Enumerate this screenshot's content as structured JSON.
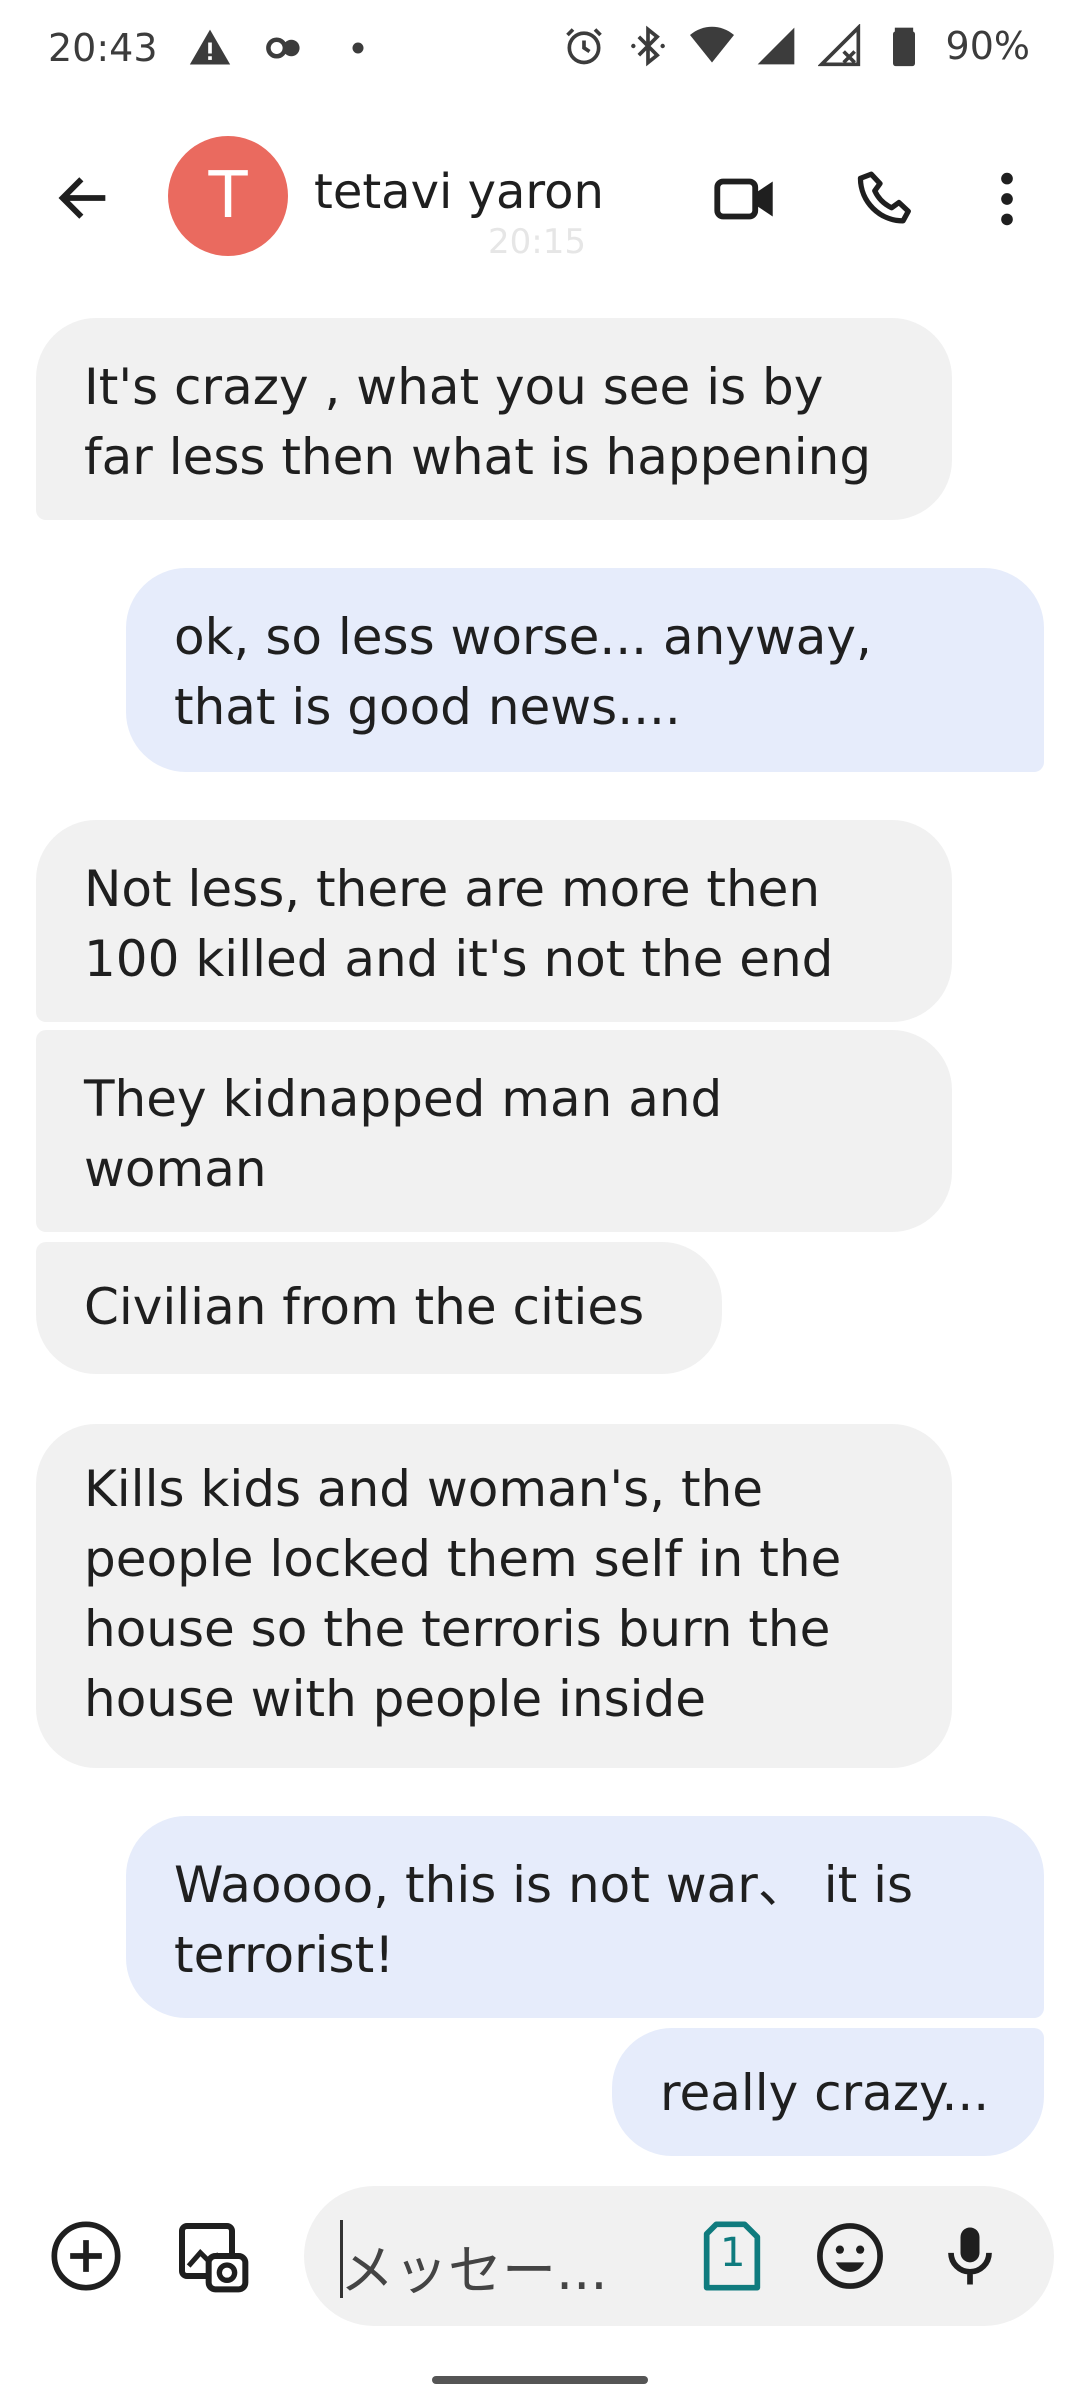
{
  "status_bar": {
    "time": "20:43",
    "battery": "90%",
    "icons": [
      "warning-icon",
      "link-icon",
      "dot-icon",
      "alarm-icon",
      "bluetooth-icon",
      "wifi-icon",
      "signal-icon",
      "signal-noservice-icon",
      "battery-icon"
    ]
  },
  "header": {
    "avatar_letter": "T",
    "contact_name": "tetavi yaron",
    "ghost_time": "20:15",
    "avatar_color": "#ea6a5f",
    "icons": [
      "back-arrow-icon",
      "video-call-icon",
      "phone-icon",
      "more-vert-icon"
    ]
  },
  "messages": [
    {
      "direction": "incoming",
      "lines": [
        "It's crazy , what you see is by",
        "far less then what is happening"
      ]
    },
    {
      "direction": "outgoing",
      "lines": [
        "ok, so less worse...  anyway,",
        "that is good news...."
      ]
    },
    {
      "direction": "incoming",
      "lines": [
        "Not less, there are more then",
        "100 killed and it's not the end"
      ]
    },
    {
      "direction": "incoming",
      "lines": [
        "They kidnapped man and",
        "woman"
      ]
    },
    {
      "direction": "incoming",
      "lines": [
        "Civilian from the cities"
      ]
    },
    {
      "direction": "incoming",
      "lines": [
        "Kills kids and woman's, the",
        "people locked them self in the",
        "house so the terroris burn the",
        "house with people inside"
      ]
    },
    {
      "direction": "outgoing",
      "lines": [
        "Waoooo, this is not war、 it is",
        "terrorist!"
      ]
    },
    {
      "direction": "outgoing",
      "lines": [
        "really crazy..."
      ]
    }
  ],
  "compose": {
    "placeholder": "メッセー...",
    "sim_label": "1",
    "icons": [
      "add-circle-icon",
      "gallery-icon",
      "sim-icon",
      "emoji-icon",
      "mic-icon"
    ]
  },
  "colors": {
    "incoming_bubble": "#f1f1f1",
    "outgoing_bubble": "#e6ecfb",
    "sim_accent": "#0f7b7e"
  }
}
